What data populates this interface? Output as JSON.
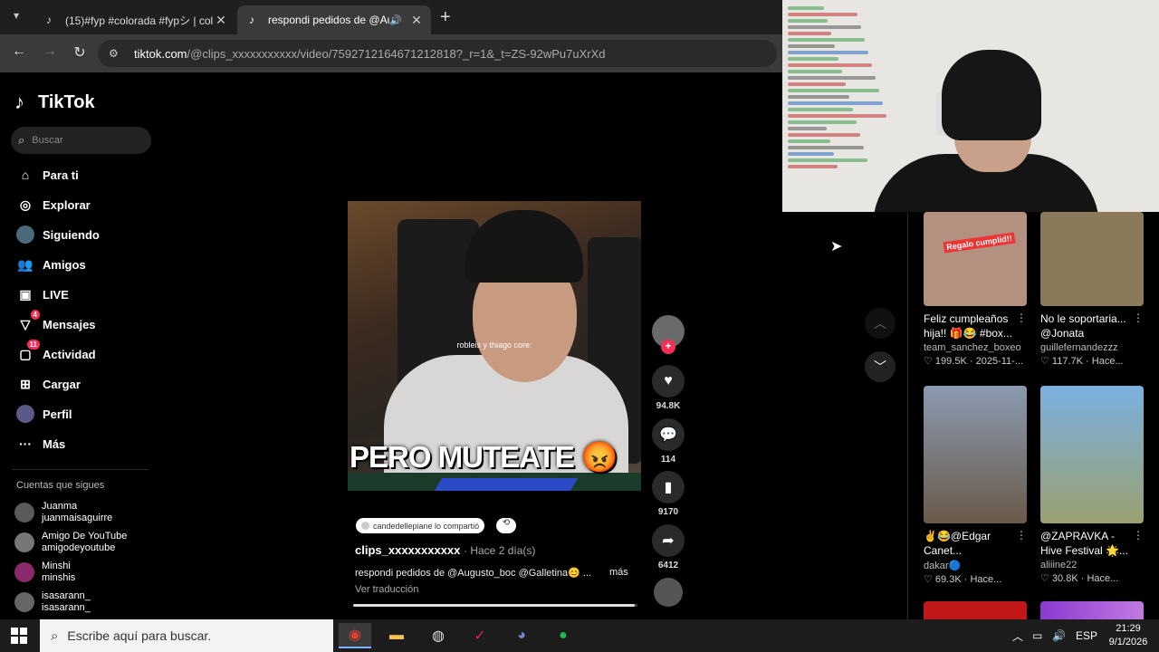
{
  "browser": {
    "tabs": [
      {
        "title": "(15)#fyp #colorada #fypシ | col",
        "active": false
      },
      {
        "title": "respondi pedidos de @Aug",
        "active": true
      }
    ],
    "url_host": "tiktok.com",
    "url_path": "/@clips_xxxxxxxxxxx/video/7592712164671212818?_r=1&_t=ZS-92wPu7uXrXd"
  },
  "tiktok": {
    "logo_text": "TikTok",
    "search_placeholder": "Buscar",
    "nav": [
      {
        "label": "Para ti",
        "icon": "home-icon"
      },
      {
        "label": "Explorar",
        "icon": "compass-icon"
      },
      {
        "label": "Siguiendo",
        "icon": "following-avatar-icon"
      },
      {
        "label": "Amigos",
        "icon": "friends-icon"
      },
      {
        "label": "LIVE",
        "icon": "live-icon"
      },
      {
        "label": "Mensajes",
        "icon": "messages-icon",
        "badge": "4"
      },
      {
        "label": "Actividad",
        "icon": "activity-icon",
        "badge": "11"
      },
      {
        "label": "Cargar",
        "icon": "upload-icon"
      },
      {
        "label": "Perfil",
        "icon": "profile-avatar-icon"
      },
      {
        "label": "Más",
        "icon": "more-icon"
      }
    ],
    "following_title": "Cuentas que sigues",
    "following": [
      {
        "name": "Juanma",
        "handle": "juanmaisaguirre",
        "color": "#5a5a5a"
      },
      {
        "name": "Amigo De YouTube",
        "handle": "amigodeyoutube",
        "color": "#777777"
      },
      {
        "name": "Minshi",
        "handle": "minshis",
        "color": "#8a2a6a"
      },
      {
        "name": "isasarann_",
        "handle": "isasarann_",
        "color": "#666666"
      }
    ]
  },
  "video": {
    "overlay_small": "robleis y thiago core:",
    "caption": "PERO MUTEATE 😡",
    "shared_text": "candedellepiane lo compartió",
    "author": "clips_xxxxxxxxxxx",
    "time": "· Hace 2 día(s)",
    "description": "respondi pedidos de @Augusto_boc @Galletina😊 ...",
    "more": "más",
    "translate": "Ver traducción",
    "progress": 0.99,
    "likes": "94.8K",
    "comments": "114",
    "saves": "9170",
    "shares": "6412"
  },
  "recommendations": [
    {
      "title": "Feliz cumpleaños hija!! 🎁😂 #box...",
      "author": "team_sanchez_boxeo",
      "likes": "199.5K",
      "date": "2025-11-...",
      "thumb_color": "#b49080",
      "thumb_text": "Regalo cumplid!!"
    },
    {
      "title": "No le soportaria... @Jonata",
      "author": "guillefernandezzz",
      "likes": "117.7K",
      "date": "Hace...",
      "thumb_color": "#8a7a5a",
      "thumb_text": ""
    },
    {
      "title": "✌️😂@Edgar Canet...",
      "author": "dakar🔵",
      "likes": "69.3K",
      "date": "Hace...",
      "thumb_color": "#6a7a9a",
      "thumb_text": ""
    },
    {
      "title": "@ZAPRAVKA - Hive Festival 🌟...",
      "author": "aliiine22",
      "likes": "30.8K",
      "date": "Hace...",
      "thumb_color": "#7a9ab8",
      "thumb_text": ""
    }
  ],
  "taskbar": {
    "search_placeholder": "Escribe aquí para buscar.",
    "lang": "ESP",
    "time": "21:29",
    "date": "9/1/2026"
  }
}
